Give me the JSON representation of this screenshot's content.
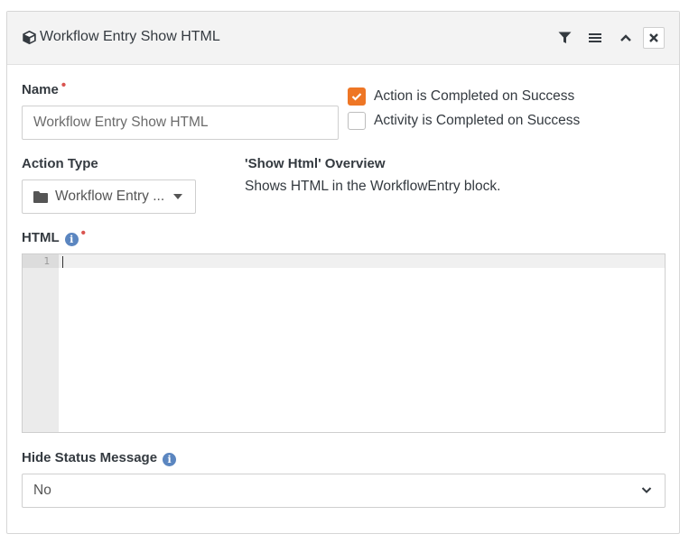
{
  "header": {
    "title": "Workflow Entry Show HTML",
    "icon": "cube-icon",
    "actions": [
      "filter-icon",
      "menu-icon",
      "chevron-up-icon",
      "close-icon"
    ]
  },
  "form": {
    "name_label": "Name",
    "name_value": "Workflow Entry Show HTML",
    "checkbox_action_completed": {
      "label": "Action is Completed on Success",
      "checked": true
    },
    "checkbox_activity_completed": {
      "label": "Activity is Completed on Success",
      "checked": false
    },
    "action_type_label": "Action Type",
    "action_type_value": "Workflow Entry ...",
    "overview_title": "'Show Html' Overview",
    "overview_desc": "Shows HTML in the WorkflowEntry block.",
    "html_label": "HTML",
    "editor_line_number": "1",
    "hide_status_label": "Hide Status Message",
    "hide_status_value": "No"
  },
  "colors": {
    "accent": "#ee7625",
    "required": "#d9534f",
    "info": "#5b86c0"
  }
}
